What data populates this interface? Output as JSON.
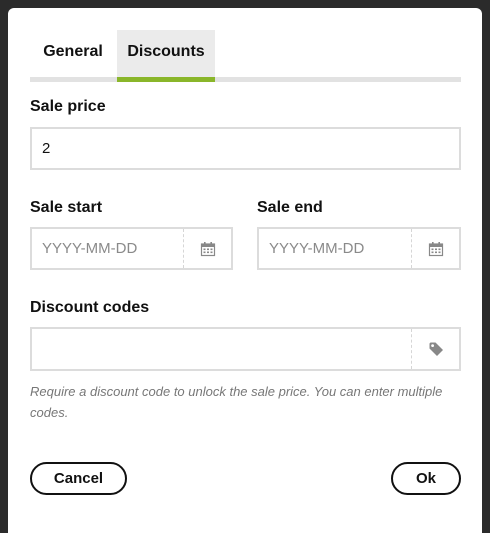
{
  "tabs": [
    {
      "label": "General",
      "active": false
    },
    {
      "label": "Discounts",
      "active": true
    }
  ],
  "sale_price": {
    "label": "Sale price",
    "value": "2"
  },
  "sale_start": {
    "label": "Sale start",
    "placeholder": "YYYY-MM-DD",
    "value": "",
    "icon": "calendar-icon"
  },
  "sale_end": {
    "label": "Sale end",
    "placeholder": "YYYY-MM-DD",
    "value": "",
    "icon": "calendar-icon"
  },
  "discount_codes": {
    "label": "Discount codes",
    "value": "",
    "icon": "tag-icon",
    "help": "Require a discount code to unlock the sale price. You can enter multiple codes."
  },
  "buttons": {
    "cancel": "Cancel",
    "ok": "Ok"
  },
  "colors": {
    "accent": "#8ab62a",
    "backdrop": "#2b2b2b"
  }
}
